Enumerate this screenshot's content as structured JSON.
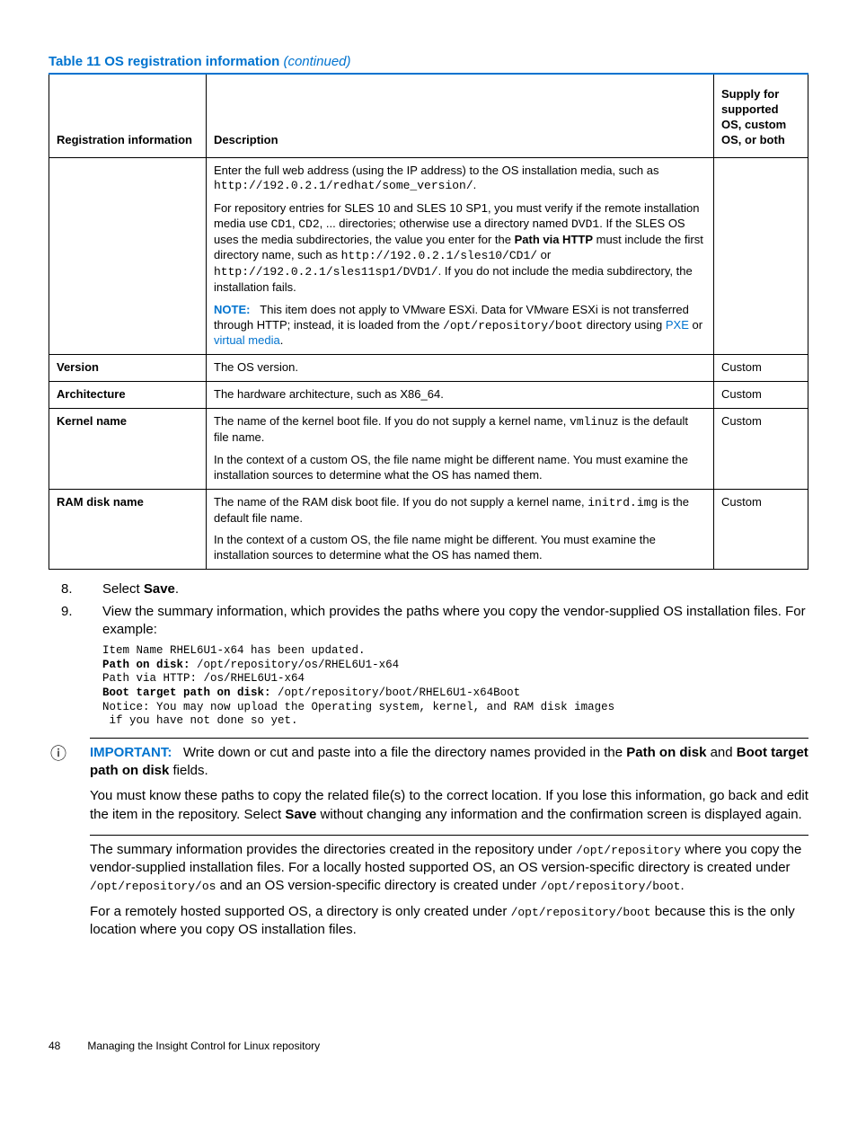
{
  "tableCaption": "Table 11 OS registration information",
  "tableCaptionSuffix": "(continued)",
  "headers": {
    "col1": "Registration information",
    "col2": "Description",
    "col3": "Supply for supported OS, custom OS, or both"
  },
  "row0": {
    "desc": {
      "p1a": "Enter the full web address (using the IP address) to the OS installation media, such as ",
      "p1b": "http://192.0.2.1/redhat/some_version/",
      "p1c": ".",
      "p2a": "For repository entries for SLES 10 and SLES 10 SP1, you must verify if the remote installation media use ",
      "p2b": "CD1",
      "p2c": ", ",
      "p2d": "CD2",
      "p2e": ", ... directories; otherwise use a directory named ",
      "p2f": "DVD1",
      "p2g": ". If the SLES OS uses the media subdirectories, the value you enter for the ",
      "p2h": "Path via HTTP",
      "p2i": " must include the first directory name, such as ",
      "p2j": "http://192.0.2.1/sles10/CD1/",
      "p2k": " or ",
      "p2l": "http://192.0.2.1/sles11sp1/DVD1/",
      "p2m": ". If you do not include the media subdirectory, the installation fails.",
      "noteLabel": "NOTE:",
      "note1": "This item does not apply to VMware ESXi. Data for VMware ESXi is not transferred through HTTP; instead, it is loaded from the ",
      "note2": "/opt/repository/boot",
      "note3": " directory using ",
      "linkPXE": "PXE",
      "noteOr": " or ",
      "linkVM": "virtual media",
      "noteEnd": "."
    }
  },
  "rowVersion": {
    "label": "Version",
    "desc": "The OS version.",
    "supply": "Custom"
  },
  "rowArch": {
    "label": "Architecture",
    "desc": "The hardware architecture, such as X86_64.",
    "supply": "Custom"
  },
  "rowKernel": {
    "label": "Kernel name",
    "p1a": "The name of the kernel boot file. If you do not supply a kernel name, ",
    "p1b": "vmlinuz",
    "p1c": " is the default file name.",
    "p2": "In the context of a custom OS, the file name might be different name. You must examine the installation sources to determine what the OS has named them.",
    "supply": "Custom"
  },
  "rowRAM": {
    "label": "RAM disk name",
    "p1a": "The name of the RAM disk boot file. If you do not supply a kernel name, ",
    "p1b": "initrd.img",
    "p1c": " is the default file name.",
    "p2": "In the context of a custom OS, the file name might be different. You must examine the installation sources to determine what the OS has named them.",
    "supply": "Custom"
  },
  "steps": {
    "n8": "8.",
    "t8a": "Select ",
    "t8b": "Save",
    "t8c": ".",
    "n9": "9.",
    "t9": "View the summary information, which provides the paths where you copy the vendor-supplied OS installation files. For example:"
  },
  "code": {
    "l1": "Item Name RHEL6U1-x64 has been updated.",
    "l2a": "Path on disk:",
    "l2b": " /opt/repository/os/RHEL6U1-x64",
    "l3": "Path via HTTP: /os/RHEL6U1-x64",
    "l4a": "Boot target path on disk:",
    "l4b": " /opt/repository/boot/RHEL6U1-x64Boot",
    "l5": "Notice: You may now upload the Operating system, kernel, and RAM disk images",
    "l6": " if you have not done so yet."
  },
  "important": {
    "label": "IMPORTANT:",
    "p1a": "Write down or cut and paste into a file the directory names provided in the ",
    "p1b": "Path on disk",
    "p1c": " and ",
    "p1d": "Boot target path on disk",
    "p1e": " fields.",
    "p2a": "You must know these paths to copy the related file(s) to the correct location. If you lose this information, go back and edit the item in the repository. Select ",
    "p2b": "Save",
    "p2c": " without changing any information and the confirmation screen is displayed again."
  },
  "post": {
    "p1a": "The summary information provides the directories created in the repository under ",
    "p1b": "/opt/repository",
    "p1c": " where you copy the vendor-supplied installation files. For a locally hosted supported OS, an OS version-specific directory is created under ",
    "p1d": "/opt/repository/os",
    "p1e": " and an OS version-specific directory is created under ",
    "p1f": "/opt/repository/boot",
    "p1g": ".",
    "p2a": "For a remotely hosted supported OS, a directory is only created under ",
    "p2b": "/opt/repository/boot",
    "p2c": " because this is the only location where you copy OS installation files."
  },
  "footer": {
    "page": "48",
    "title": "Managing the Insight Control for Linux repository"
  }
}
